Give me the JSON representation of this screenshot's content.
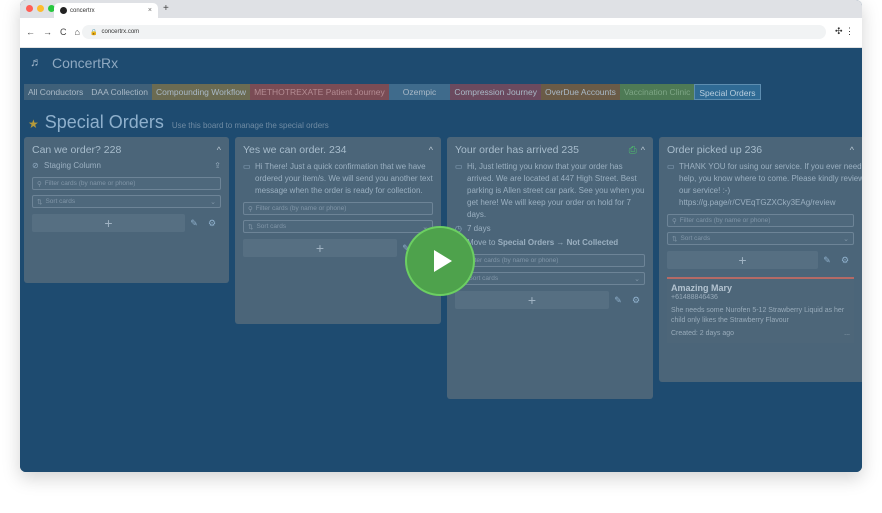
{
  "browser": {
    "tab_title": "concertrx",
    "tab_close": "×",
    "new_tab": "+",
    "url": "concertrx.com",
    "nav": {
      "back": "←",
      "forward": "→",
      "reload": "C",
      "home": "⌂"
    },
    "lights": [
      "#ff5f57",
      "#febc2e",
      "#28c840"
    ]
  },
  "app": {
    "logo_text": "ConcertRx",
    "boards": [
      {
        "label": "All Conductors",
        "bg": "#3f6079"
      },
      {
        "label": "DAA Collection",
        "bg": "#3f6079"
      },
      {
        "label": "Compounding Workflow",
        "bg": "#6b6b52"
      },
      {
        "label": "METHOTREXATE Patient Journey",
        "bg": "#7a4c55"
      },
      {
        "label": "Ozempic",
        "bg": "#3f6b8c"
      },
      {
        "label": "Compression Journey",
        "bg": "#6b4a5f"
      },
      {
        "label": "OverDue Accounts",
        "bg": "#6a5b47"
      },
      {
        "label": "Vaccination Clinic",
        "bg": "#4e7a55"
      },
      {
        "label": "Special Orders",
        "bg": "#2f6a94"
      }
    ],
    "page_title": "Special Orders",
    "page_subtitle": "Use this board to manage the special orders",
    "filter_placeholder": "Filter cards (by name or phone)",
    "sort_label": "Sort cards",
    "add_symbol": "+",
    "columns": [
      {
        "title": "Can we order? 228",
        "collapse": "^",
        "staging": "Staging Column",
        "message": ""
      },
      {
        "title": "Yes we can order. 234",
        "collapse": "^",
        "message": "Hi There! Just a quick confirmation that we have ordered your item/s. We will send you another text message when the order is ready for collection."
      },
      {
        "title": "Your order has arrived 235",
        "collapse": "^",
        "message": "Hi, Just letting you know that your order has arrived. We are located at 447 High Street. Best parking is Allen street car park. See you when you get here! We will keep your order on hold for 7 days.",
        "days": "7 days",
        "move_prefix": "Move to ",
        "move_target": "Special Orders → Not Collected"
      },
      {
        "title": "Order picked up 236",
        "collapse": "^",
        "message": "THANK YOU for using our service. If you ever need help, you know where to come. Please kindly review our service! :-) https://g.page/r/CVEqTGZXCky3EAg/review",
        "card": {
          "name": "Amazing Mary",
          "phone": "+61488846436",
          "note": "She needs some Nurofen 5-12 Strawberry Liquid as her child only likes the Strawberry Flavour",
          "created": "Created: 2 days ago",
          "more": "..."
        }
      }
    ]
  }
}
